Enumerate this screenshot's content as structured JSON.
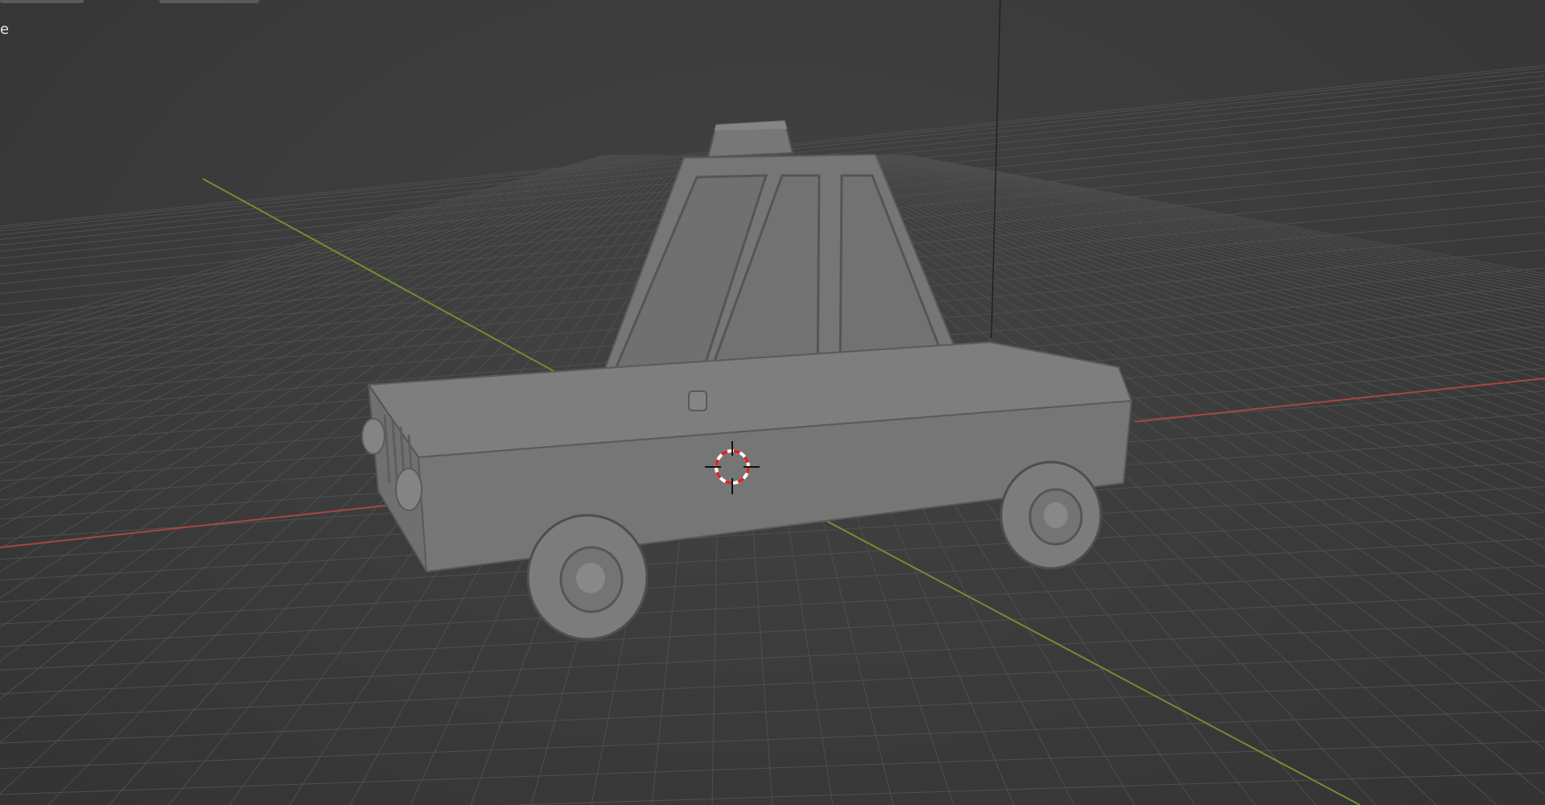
{
  "header": {
    "view_label": "e"
  },
  "viewport": {
    "colors": {
      "background": "#3d3d3d",
      "grid": "#4f4f4f",
      "x_axis": "#a84545",
      "y_axis": "#6f8f2f",
      "z_axis": "#222222",
      "model": "#7b7b7b",
      "cursor_red": "#d42a2a"
    },
    "objects": [
      {
        "name": "Car",
        "parts": [
          "body",
          "cabin",
          "roof-light",
          "front-wheel",
          "rear-wheel",
          "headlights",
          "grille",
          "side-mirror"
        ]
      },
      {
        "name": "3D Cursor",
        "icon": "crosshair-cursor-icon"
      }
    ]
  }
}
